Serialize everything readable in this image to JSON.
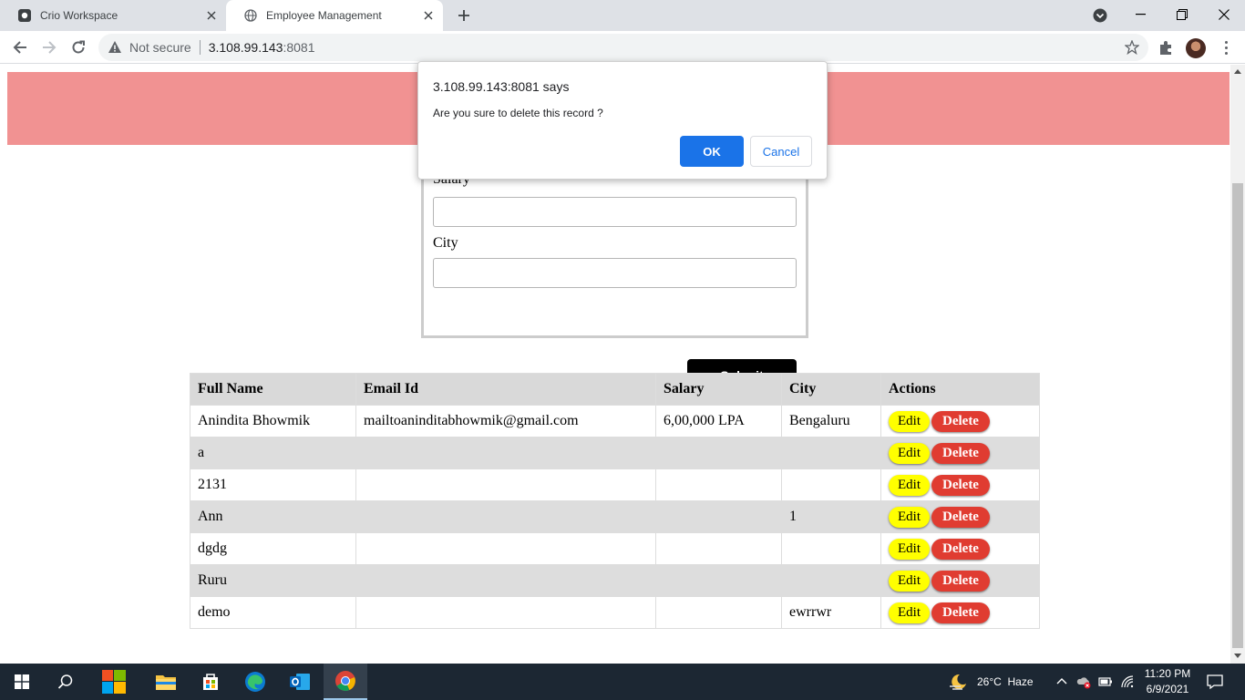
{
  "browser": {
    "tabs": [
      {
        "label": "Crio Workspace",
        "icon": "crio-favicon",
        "active": false
      },
      {
        "label": "Employee Management",
        "icon": "globe-icon",
        "active": true
      }
    ],
    "address": {
      "security_label": "Not secure",
      "host": "3.108.99.143",
      "port": ":8081"
    }
  },
  "form": {
    "salary_label": "Salary",
    "city_label": "City",
    "submit_label": "Submit"
  },
  "table": {
    "headers": [
      "Full Name",
      "Email Id",
      "Salary",
      "City",
      "Actions"
    ],
    "rows": [
      [
        "Anindita Bhowmik",
        "mailtoaninditabhowmik@gmail.com",
        "6,00,000 LPA",
        "Bengaluru"
      ],
      [
        "a",
        "",
        "",
        ""
      ],
      [
        "2131",
        "",
        "",
        ""
      ],
      [
        "Ann",
        "",
        "",
        "1"
      ],
      [
        "dgdg",
        "",
        "",
        ""
      ],
      [
        "Ruru",
        "",
        "",
        ""
      ],
      [
        "demo",
        "",
        "",
        "ewrrwr"
      ]
    ],
    "edit_label": "Edit",
    "delete_label": "Delete"
  },
  "dialog": {
    "title": "3.108.99.143:8081 says",
    "message": "Are you sure to delete this record ?",
    "ok_label": "OK",
    "cancel_label": "Cancel"
  },
  "taskbar": {
    "weather": "26°C  Haze",
    "time": "11:20 PM",
    "date": "6/9/2021"
  },
  "colors": {
    "banner": "#f19292",
    "accent": "#1a73e8",
    "edit": "#ffff00",
    "delete": "#e03c31"
  }
}
